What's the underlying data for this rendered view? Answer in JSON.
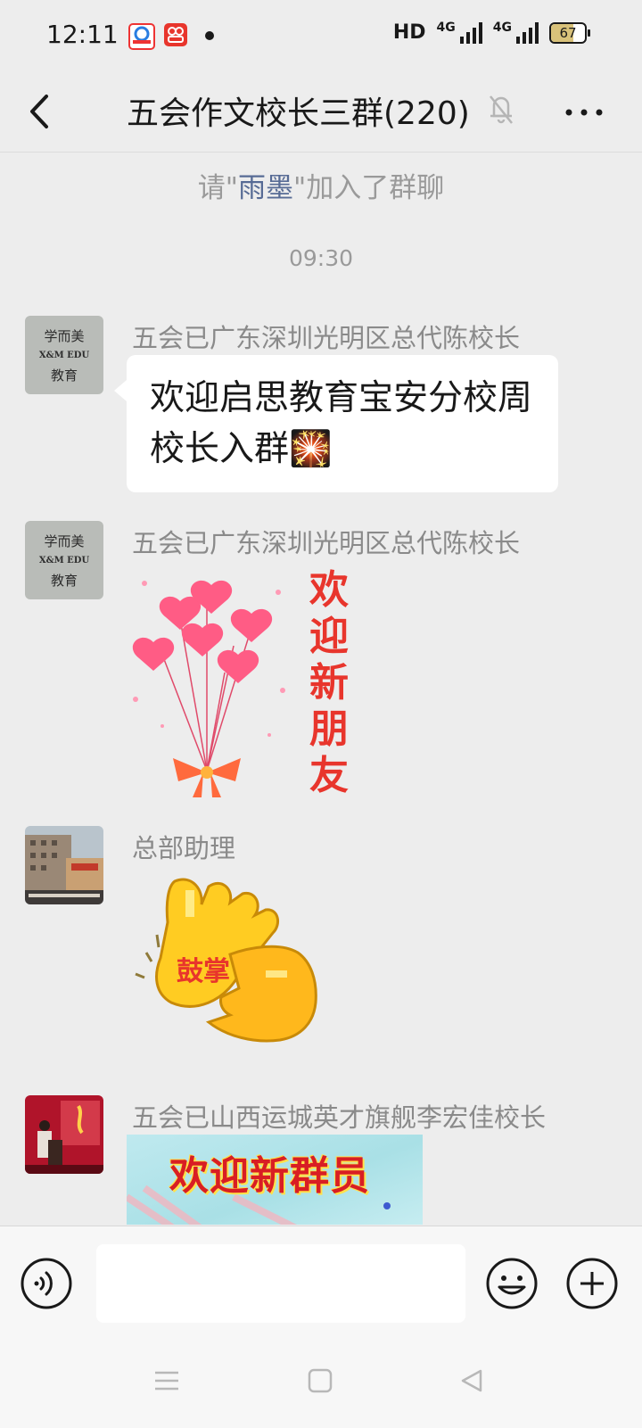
{
  "status_bar": {
    "time": "12:11",
    "hd_label": "HD",
    "network_1": "4G",
    "network_2": "4G",
    "battery": "67",
    "battery_level": 0.67
  },
  "header": {
    "title": "五会作文校长三群(220)"
  },
  "system_message": {
    "prefix": "请\"",
    "name": "雨墨",
    "suffix": "\"加入了群聊"
  },
  "timestamp": "09:30",
  "messages": [
    {
      "sender": "五会已广东深圳光明区总代陈校长",
      "avatar_text": [
        "学而美",
        "X&M EDU",
        "教育"
      ],
      "text": "欢迎启思教育宝安分校周校长入群🎇"
    },
    {
      "sender": "五会已广东深圳光明区总代陈校长",
      "avatar_text": [
        "学而美",
        "X&M EDU",
        "教育"
      ],
      "sticker_text": [
        "欢",
        "迎",
        "新",
        "朋",
        "友"
      ]
    },
    {
      "sender": "总部助理",
      "sticker_text": "鼓掌"
    },
    {
      "sender": "五会已山西运城英才旗舰李宏佳校长",
      "sticker_text": "欢迎新群员"
    }
  ],
  "colors": {
    "background": "#ededed",
    "link": "#576b95",
    "heart": "#ff4d7a",
    "sticker_red": "#e8352c",
    "hand_yellow": "#ffcc22"
  }
}
